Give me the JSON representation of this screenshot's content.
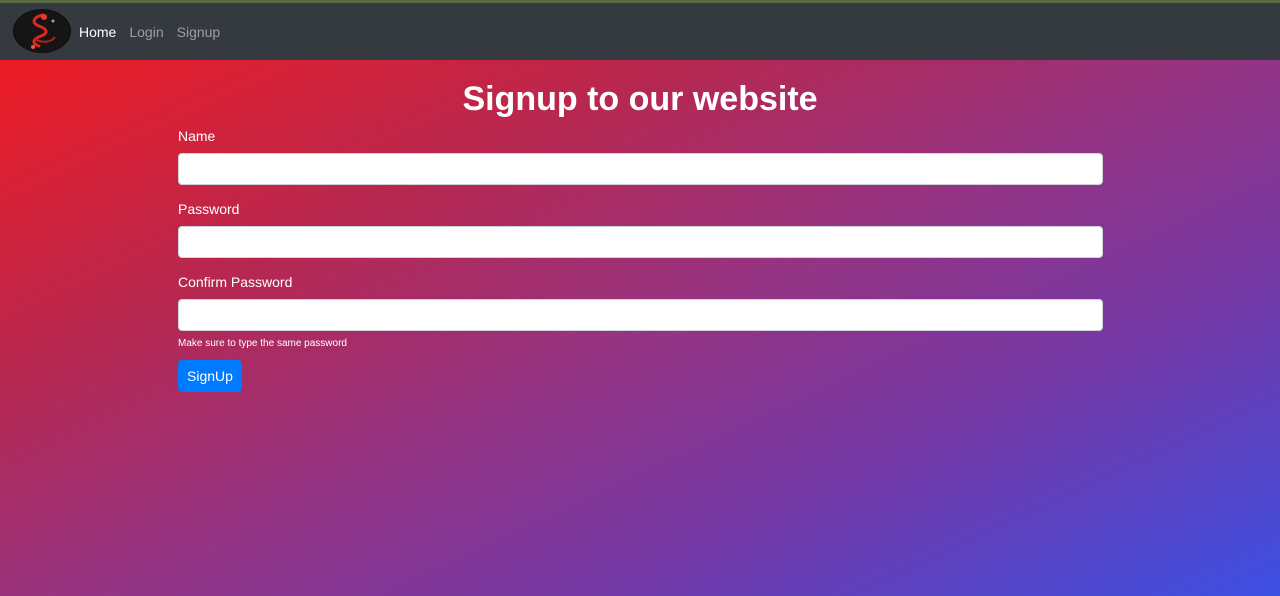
{
  "nav": {
    "logo_icon": "dragon-logo-icon",
    "items": [
      {
        "label": "Home",
        "active": true
      },
      {
        "label": "Login",
        "active": false
      },
      {
        "label": "Signup",
        "active": false
      }
    ]
  },
  "page": {
    "title": "Signup to our website"
  },
  "form": {
    "name": {
      "label": "Name",
      "value": ""
    },
    "password": {
      "label": "Password",
      "value": ""
    },
    "confirm_password": {
      "label": "Confirm Password",
      "value": "",
      "help": "Make sure to type the same password"
    },
    "submit_label": "SignUp"
  },
  "colors": {
    "navbar": "#343a40",
    "gradient_start": "#ee1c24",
    "gradient_end": "#3c4fe3",
    "button": "#007bff"
  }
}
